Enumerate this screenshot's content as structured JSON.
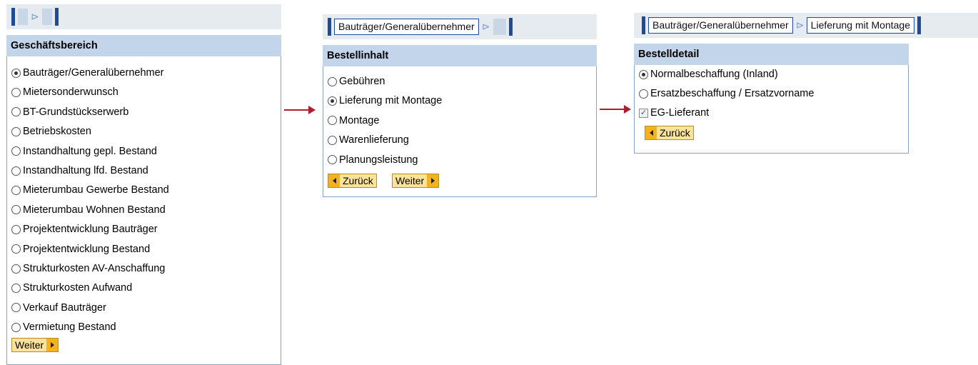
{
  "colors": {
    "nav_blue": "#1f4a96",
    "header_bg": "#c3d5ea",
    "button_bg": "#fbe39a",
    "button_arrow": "#f5b21b",
    "flow_arrow": "#b01e2e"
  },
  "step1": {
    "header": "Geschäftsbereich",
    "options": [
      {
        "label": "Bauträger/Generalübernehmer",
        "selected": true
      },
      {
        "label": "Mietersonderwunsch",
        "selected": false
      },
      {
        "label": "BT-Grundstückserwerb",
        "selected": false
      },
      {
        "label": "Betriebskosten",
        "selected": false
      },
      {
        "label": "Instandhaltung gepl. Bestand",
        "selected": false
      },
      {
        "label": "Instandhaltung lfd. Bestand",
        "selected": false
      },
      {
        "label": "Mieterumbau Gewerbe Bestand",
        "selected": false
      },
      {
        "label": "Mieterumbau Wohnen Bestand",
        "selected": false
      },
      {
        "label": "Projektentwicklung Bauträger",
        "selected": false
      },
      {
        "label": "Projektentwicklung Bestand",
        "selected": false
      },
      {
        "label": "Strukturkosten AV-Anschaffung",
        "selected": false
      },
      {
        "label": "Strukturkosten Aufwand",
        "selected": false
      },
      {
        "label": "Verkauf Bauträger",
        "selected": false
      },
      {
        "label": "Vermietung Bestand",
        "selected": false
      }
    ],
    "next_label": "Weiter"
  },
  "step2": {
    "breadcrumb": [
      "Bauträger/Generalübernehmer"
    ],
    "header": "Bestellinhalt",
    "options": [
      {
        "label": "Gebühren",
        "selected": false
      },
      {
        "label": "Lieferung mit Montage",
        "selected": true
      },
      {
        "label": "Montage",
        "selected": false
      },
      {
        "label": "Warenlieferung",
        "selected": false
      },
      {
        "label": "Planungsleistung",
        "selected": false
      }
    ],
    "back_label": "Zurück",
    "next_label": "Weiter"
  },
  "step3": {
    "breadcrumb": [
      "Bauträger/Generalübernehmer",
      "Lieferung mit Montage"
    ],
    "header": "Bestelldetail",
    "options": [
      {
        "label": "Normalbeschaffung (Inland)",
        "selected": true
      },
      {
        "label": "Ersatzbeschaffung / Ersatzvorname",
        "selected": false
      }
    ],
    "checkbox": {
      "label": "EG-Lieferant",
      "checked": true
    },
    "back_label": "Zurück"
  }
}
